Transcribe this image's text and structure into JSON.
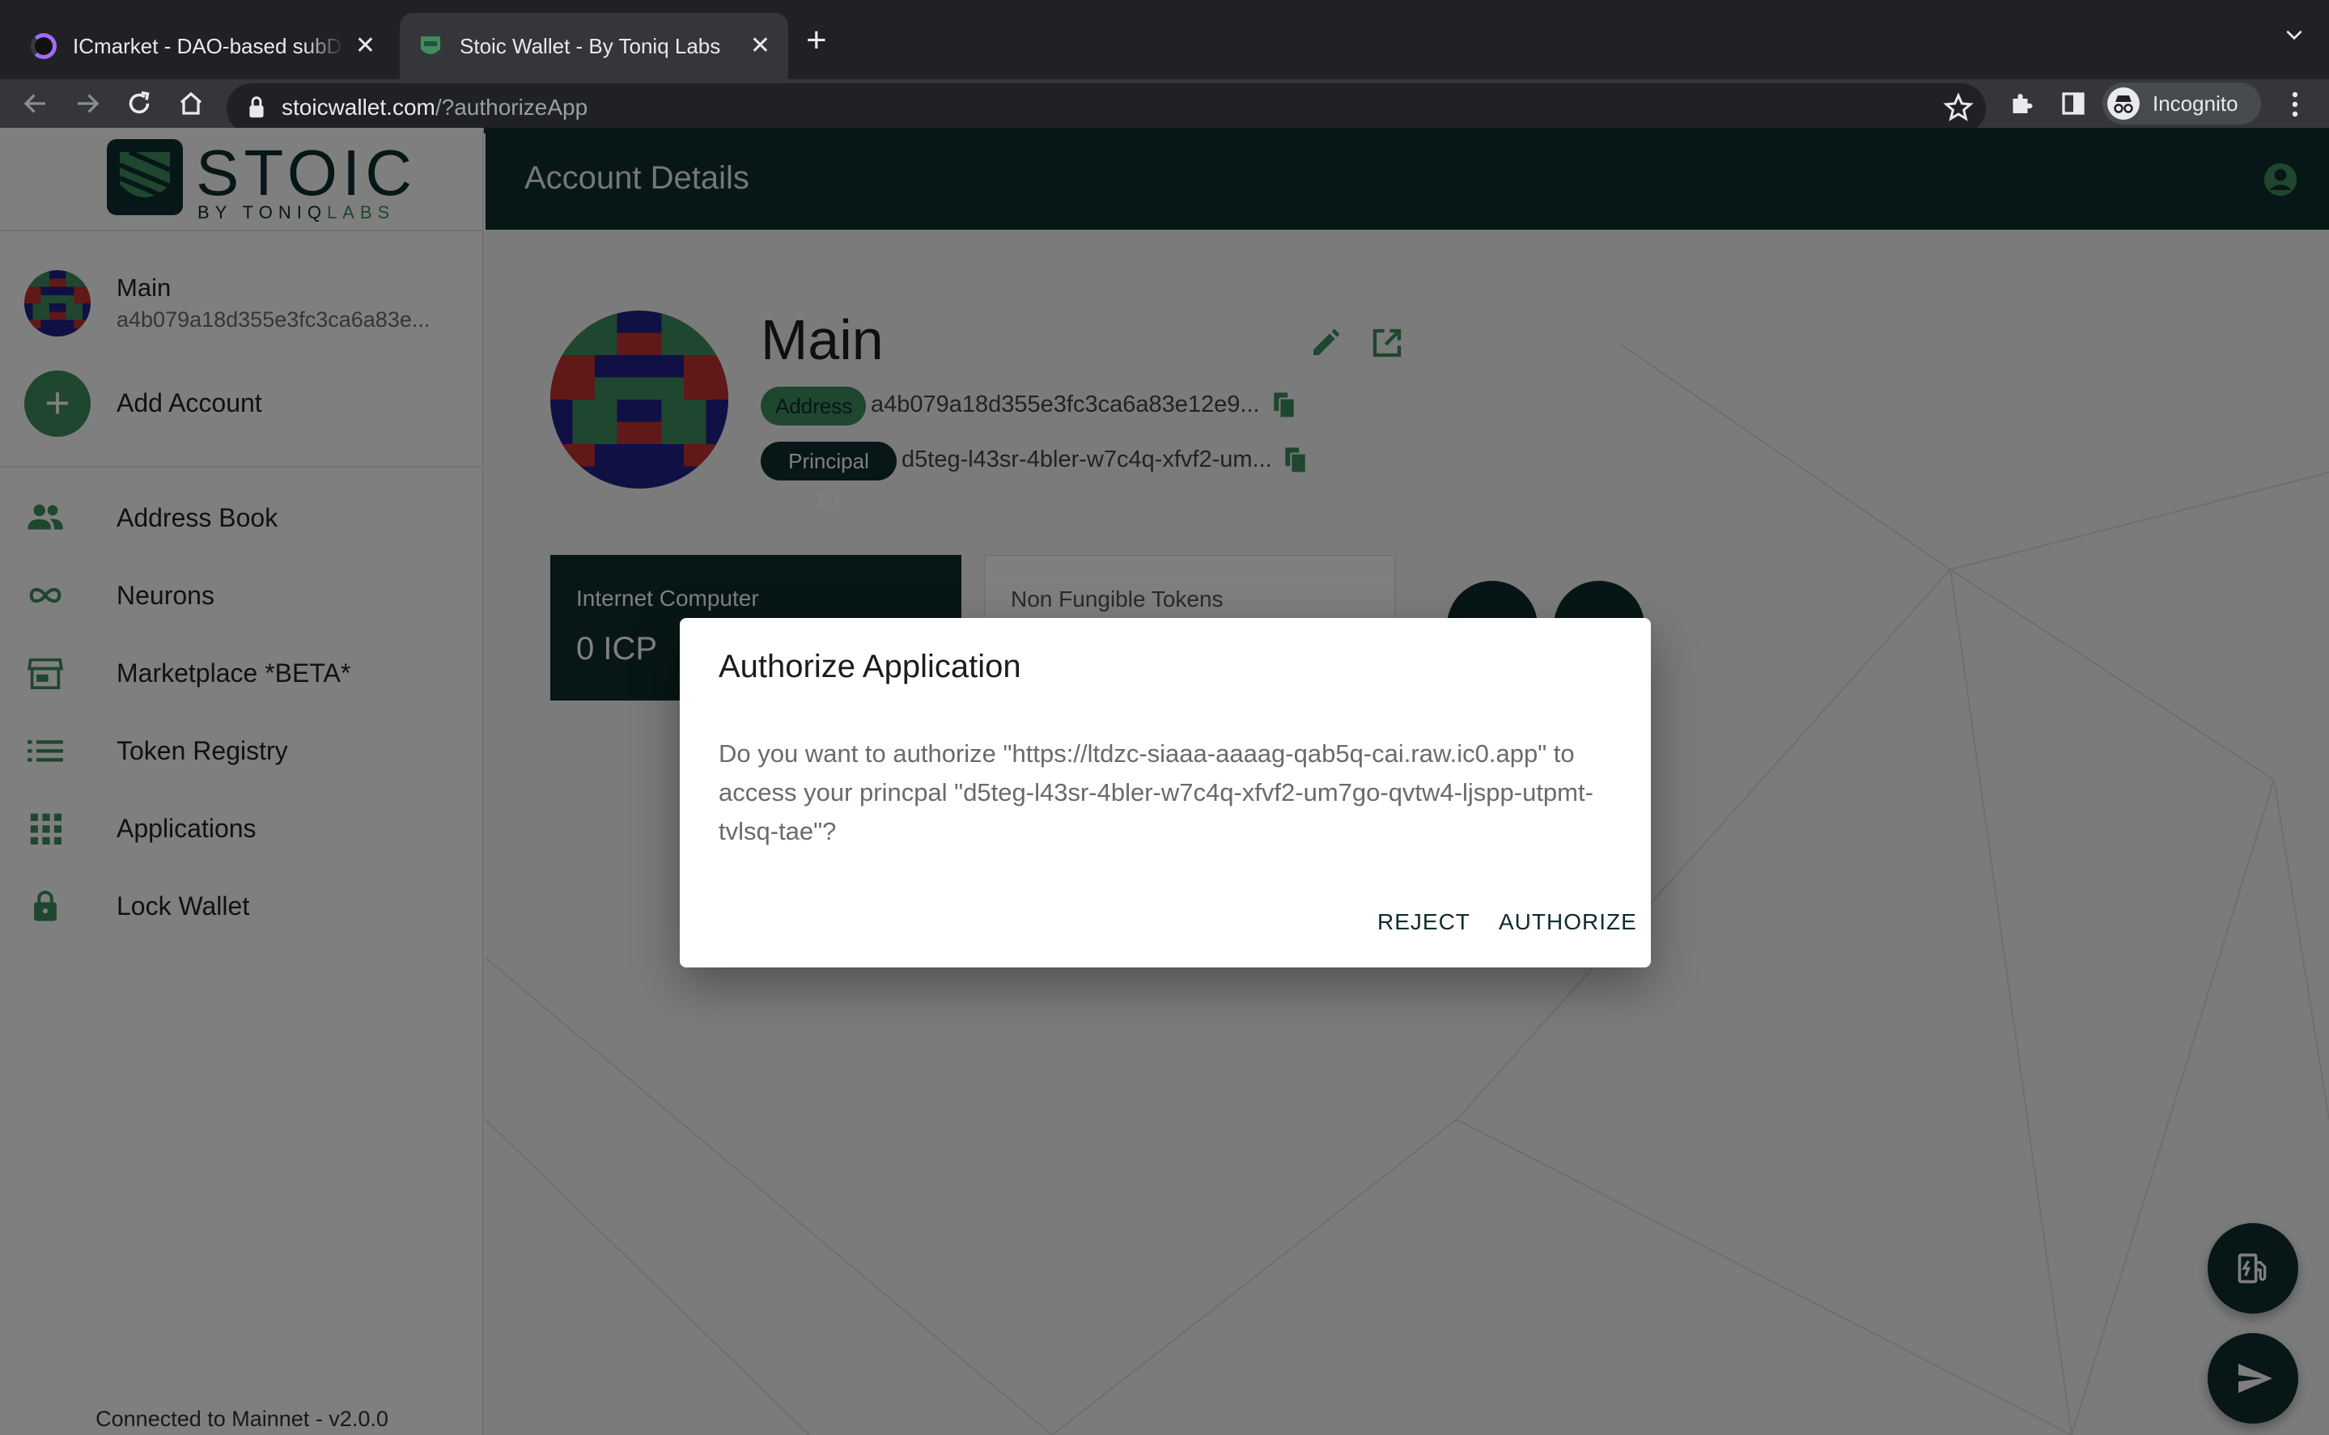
{
  "browser": {
    "tabs": [
      {
        "title": "ICmarket - DAO-based subDAO",
        "favicon": "icmarket-favicon"
      },
      {
        "title": "Stoic Wallet - By Toniq Labs",
        "favicon": "stoic-favicon"
      }
    ],
    "url_host": "stoicwallet.com",
    "url_path": "/?authorizeApp",
    "profile_label": "Incognito"
  },
  "sidebar": {
    "logo_text": "STOIC",
    "logo_sub_a": "BY TONIQ",
    "logo_sub_b": "LABS",
    "account": {
      "name": "Main",
      "address": "a4b079a18d355e3fc3ca6a83e..."
    },
    "add_account_label": "Add Account",
    "items": [
      {
        "label": "Address Book",
        "icon": "people-icon"
      },
      {
        "label": "Neurons",
        "icon": "infinity-icon"
      },
      {
        "label": "Marketplace *BETA*",
        "icon": "store-icon"
      },
      {
        "label": "Token Registry",
        "icon": "list-icon"
      },
      {
        "label": "Applications",
        "icon": "apps-grid-icon"
      },
      {
        "label": "Lock Wallet",
        "icon": "lock-icon"
      }
    ],
    "footer": "Connected to Mainnet - v2.0.0"
  },
  "header": {
    "title": "Account Details"
  },
  "account": {
    "name": "Main",
    "address_chip": "Address",
    "address": "a4b079a18d355e3fc3ca6a83e12e9...",
    "principal_chip": "Principal ID",
    "principal": "d5teg-l43sr-4bler-w7c4q-xfvf2-um..."
  },
  "cards": {
    "icp": {
      "title": "Internet Computer",
      "value": "0 ICP"
    },
    "nft": {
      "title": "Non Fungible Tokens"
    }
  },
  "dialog": {
    "title": "Authorize Application",
    "body": "Do you want to authorize \"https://ltdzc-siaaa-aaaag-qab5q-cai.raw.ic0.app\" to access your princpal \"d5teg-l43sr-4bler-w7c4q-xfvf2-um7go-qvtw4-ljspp-utpmt-tvlsq-tae\"?",
    "reject": "Reject",
    "authorize": "Authorize"
  },
  "colors": {
    "brand_dark": "#0f2c2c",
    "brand_green": "#3f8d5d",
    "avatar_red": "#c0332e",
    "avatar_blue": "#20208a",
    "avatar_green": "#3f8d5d"
  }
}
